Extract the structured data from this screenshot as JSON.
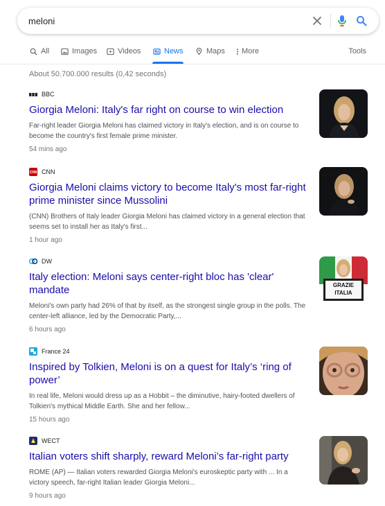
{
  "search": {
    "query": "meloni"
  },
  "tabs": [
    {
      "label": "All",
      "icon": "search-icon"
    },
    {
      "label": "Images",
      "icon": "image-icon"
    },
    {
      "label": "Videos",
      "icon": "video-icon"
    },
    {
      "label": "News",
      "icon": "news-icon",
      "active": true
    },
    {
      "label": "Maps",
      "icon": "map-pin-icon"
    },
    {
      "label": "More",
      "icon": "more-vertical-icon"
    }
  ],
  "tools_label": "Tools",
  "result_stats": "About 50.700.000 results (0,42 seconds)",
  "colors": {
    "link": "#1a0dab",
    "accent": "#1a73e8",
    "snippet": "#4d5156",
    "meta": "#70757a"
  },
  "results": [
    {
      "source": "BBC",
      "title": "Giorgia Meloni: Italy's far right on course to win election",
      "snippet": "Far-right leader Giorgia Meloni has claimed victory in Italy's election, and is on course to become the country's first female prime minister.",
      "age": "54 mins ago"
    },
    {
      "source": "CNN",
      "title": "Giorgia Meloni claims victory to become Italy's most far-right prime minister since Mussolini",
      "snippet": "(CNN) Brothers of Italy leader Giorgia Meloni has claimed victory in a general election that seems set to install her as Italy's first...",
      "age": "1 hour ago"
    },
    {
      "source": "DW",
      "title": "Italy election: Meloni says center-right bloc has 'clear' mandate",
      "snippet": "Meloni's own party had 26% of that by itself, as the strongest single group in the polls. The center-left alliance, led by the Democratic Party,...",
      "age": "6 hours ago",
      "thumb_sign": [
        "GRAZIE",
        "ITALIA"
      ]
    },
    {
      "source": "France 24",
      "title": "Inspired by Tolkien, Meloni is on a quest for Italy’s ‘ring of power’",
      "snippet": "In real life, Meloni would dress up as a Hobbit – the diminutive, hairy-footed dwellers of Tolkien's mythical Middle Earth. She and her fellow...",
      "age": "15 hours ago"
    },
    {
      "source": "WECT",
      "title": "Italian voters shift sharply, reward Meloni’s far-right party",
      "snippet": "ROME (AP) — Italian voters rewarded Giorgia Meloni's euroskeptic party with ... In a victory speech, far-right Italian leader Giorgia Meloni...",
      "age": "9 hours ago"
    }
  ]
}
